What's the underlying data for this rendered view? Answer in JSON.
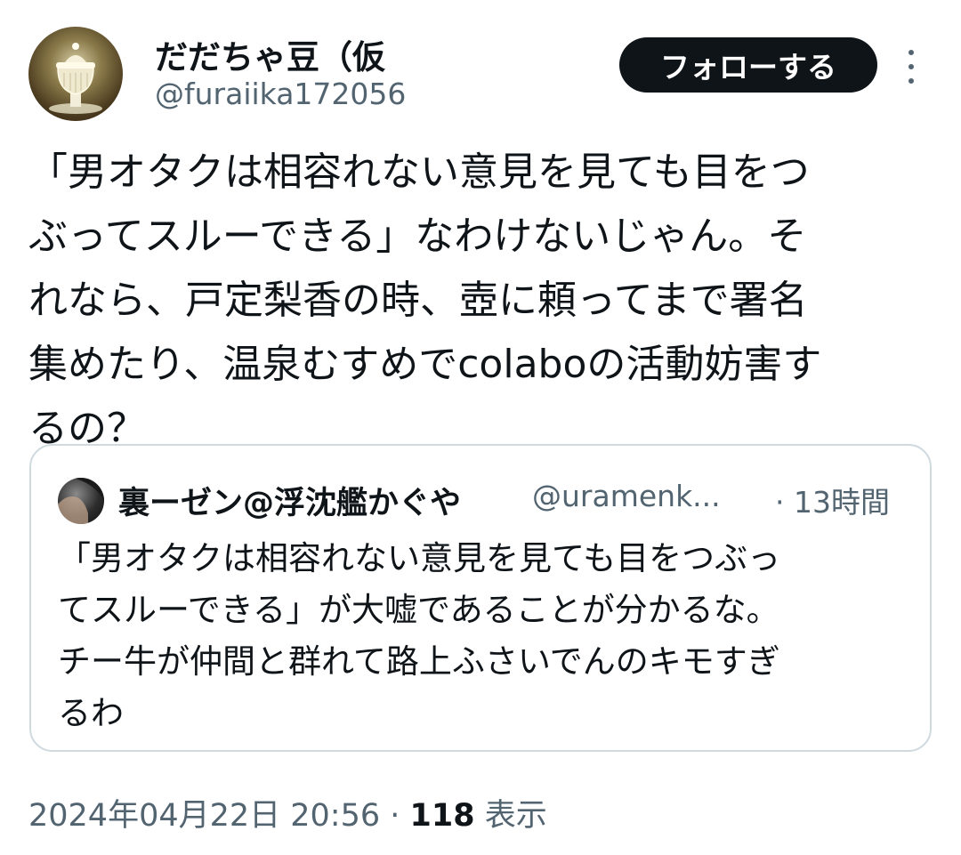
{
  "author": {
    "display_name": "だだちゃ豆（仮",
    "handle": "@furaiika172056"
  },
  "follow_button": "フォローする",
  "tweet": {
    "text": "「男オタクは相容れない意見を見ても目をつ\nぶってスルーできる」なわけないじゃん。そ\nれなら、戸定梨香の時、壺に頼ってまで署名\n集めたり、温泉むすめでcolaboの活動妨害す\nるの？"
  },
  "quote": {
    "display_name": "裏ーゼン@浮沈艦かぐや",
    "handle": "@uramenk...",
    "time": "· 13時間",
    "text": "「男オタクは相容れない意見を見ても目をつぶっ\nてスルーできる」が大嘘であることが分かるな。\nチー牛が仲間と群れて路上ふさいでんのキモすぎ\nるわ"
  },
  "meta": {
    "datetime": "2024年04月22日 20:56",
    "separator": " · ",
    "views_count": "118",
    "views_label": " 表示"
  }
}
